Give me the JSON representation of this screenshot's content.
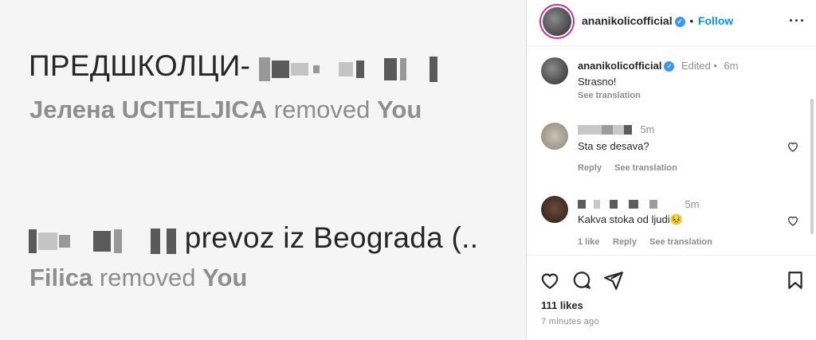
{
  "left_image": {
    "group1": {
      "title_prefix": "ПРЕДШКОЛЦИ-",
      "removed_by": "Јелена UCITELJICA",
      "removed_word": "removed",
      "removed_target": "You"
    },
    "group2": {
      "title_suffix": "prevoz iz Beograda (..",
      "removed_by": "Filica",
      "removed_word": "removed",
      "removed_target": "You"
    }
  },
  "post": {
    "username": "ananikolicofficial",
    "follow_label": "Follow",
    "header_separator": "•",
    "caption": {
      "username": "ananikolicofficial",
      "edited_label": "Edited •",
      "time": "6m",
      "text": "Strasno!",
      "see_translation": "See translation"
    },
    "comments": [
      {
        "time": "5m",
        "text": "Sta se desava?",
        "reply": "Reply",
        "see_translation": "See translation"
      },
      {
        "time": "5m",
        "text": "Kakva stoka od ljudi😣",
        "likes": "1 like",
        "reply": "Reply",
        "see_translation": "See translation"
      }
    ],
    "likes": "111 likes",
    "posted": "7 minutes ago"
  },
  "colors": {
    "accent": "#0095f6",
    "verified": "#3897f0",
    "text": "#262626",
    "muted": "#8e8e8e"
  },
  "icons": [
    "more-icon",
    "verified-icon",
    "heart-icon",
    "comment-icon",
    "share-icon",
    "save-icon"
  ]
}
